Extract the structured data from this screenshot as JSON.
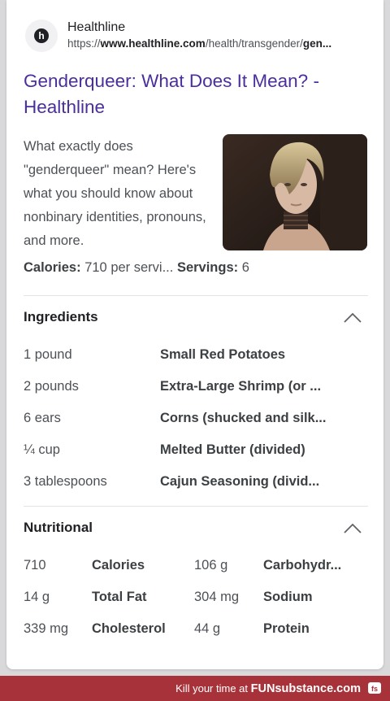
{
  "result": {
    "site_name": "Healthline",
    "url_prefix": "https://",
    "url_domain": "www.healthline.com",
    "url_path": "/health/transgender/",
    "url_tail": "gen...",
    "title": "Genderqueer: What Does It Mean? - Healthline",
    "snippet": "What exactly does \"genderqueer\" mean? Here's what you should know about nonbinary identities, pronouns, and more.",
    "calories_label": "Calories:",
    "calories_value": "710 per servi...",
    "servings_label": "Servings:",
    "servings_value": "6"
  },
  "ingredients": {
    "title": "Ingredients",
    "items": [
      {
        "qty": "1 pound",
        "name": "Small Red Potatoes"
      },
      {
        "qty": "2 pounds",
        "name": "Extra-Large Shrimp (or ..."
      },
      {
        "qty": "6 ears",
        "name": "Corns (shucked and silk..."
      },
      {
        "qty": "¼ cup",
        "name": "Melted Butter (divided)"
      },
      {
        "qty": "3 tablespoons",
        "name": "Cajun Seasoning (divid..."
      }
    ]
  },
  "nutritional": {
    "title": "Nutritional",
    "rows": [
      {
        "v1": "710",
        "l1": "Calories",
        "v2": "106 g",
        "l2": "Carbohydr..."
      },
      {
        "v1": "14 g",
        "l1": "Total Fat",
        "v2": "304 mg",
        "l2": "Sodium"
      },
      {
        "v1": "339 mg",
        "l1": "Cholesterol",
        "v2": "44 g",
        "l2": "Protein"
      }
    ]
  },
  "footer": {
    "text": "Kill your time at ",
    "brand": "FUNsubstance.com",
    "icon": "fs-logo-icon",
    "color": "#a8323a"
  },
  "colors": {
    "title_link": "#4b2e9e",
    "body_text": "#4d5156"
  }
}
